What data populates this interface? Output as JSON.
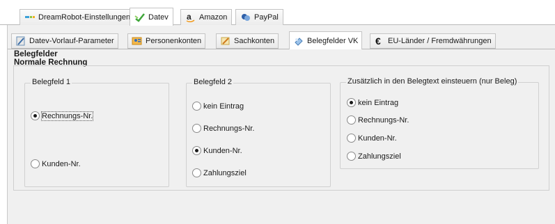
{
  "main_tabs": [
    {
      "label": "DreamRobot-Einstellungen",
      "icon": "dreamrobot-icon",
      "active": false
    },
    {
      "label": "Datev",
      "icon": "datev-icon",
      "active": true
    },
    {
      "label": "Amazon",
      "icon": "amazon-icon",
      "active": false
    },
    {
      "label": "PayPal",
      "icon": "paypal-icon",
      "active": false
    }
  ],
  "sub_tabs": [
    {
      "label": "Datev-Vorlauf-Parameter",
      "icon": "parameter-icon",
      "active": false
    },
    {
      "label": "Personenkonten",
      "icon": "persons-icon",
      "active": false
    },
    {
      "label": "Sachkonten",
      "icon": "accounts-icon",
      "active": false
    },
    {
      "label": "Belegfelder VK",
      "icon": "document-icon",
      "active": true
    },
    {
      "label": "EU-Länder / Fremdwährungen",
      "icon": "euro-icon",
      "active": false
    }
  ],
  "section": {
    "title": "Belegfelder",
    "subtitle": "Normale Rechnung"
  },
  "groups": {
    "belegfeld1": {
      "title": "Belegfeld 1",
      "options": [
        {
          "label": "Rechnungs-Nr.",
          "checked": true
        },
        {
          "label": "Kunden-Nr.",
          "checked": false
        }
      ]
    },
    "belegfeld2": {
      "title": "Belegfeld 2",
      "options": [
        {
          "label": "kein Eintrag",
          "checked": false
        },
        {
          "label": "Rechnungs-Nr.",
          "checked": false
        },
        {
          "label": "Kunden-Nr.",
          "checked": true
        },
        {
          "label": "Zahlungsziel",
          "checked": false
        }
      ]
    },
    "belegtext": {
      "title": "Zusätzlich in den Belegtext einsteuern (nur Beleg)",
      "options": [
        {
          "label": "kein Eintrag",
          "checked": true
        },
        {
          "label": "Rechnungs-Nr.",
          "checked": false
        },
        {
          "label": "Kunden-Nr.",
          "checked": false
        },
        {
          "label": "Zahlungsziel",
          "checked": false
        }
      ]
    }
  },
  "colors": {
    "panel_bg": "#f0f0f0",
    "datev_green": "#3fa63a",
    "amazon_dark": "#222222",
    "amazon_orange": "#f29b1d",
    "paypal_blue": "#2e5fa8"
  }
}
